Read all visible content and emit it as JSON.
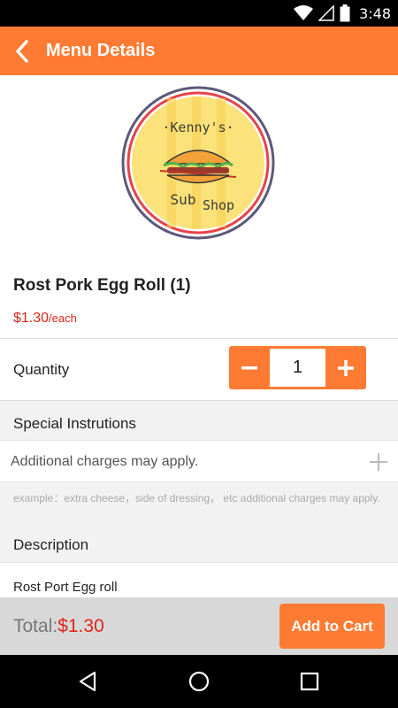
{
  "status_bar": {
    "time": "3:48",
    "icons": [
      "wifi-icon",
      "signal-icon",
      "battery-icon"
    ]
  },
  "app_bar": {
    "title": "Menu Details",
    "back_icon": "chevron-left-icon"
  },
  "logo": {
    "line1": "·Kenny's·",
    "line2a": "Sub",
    "line2b": "Shop"
  },
  "item": {
    "name": "Rost Pork Egg Roll (1)",
    "price": "$1.30",
    "price_unit": "/each"
  },
  "quantity": {
    "label": "Quantity",
    "value": "1",
    "minus_label": "−",
    "plus_label": "+"
  },
  "special_instructions": {
    "heading": "Special Instrutions",
    "placeholder": "Additional charges may apply.",
    "hint": "example：extra cheese，side of dressing， etc additional charges may apply."
  },
  "description": {
    "heading": "Description",
    "text": "Rost Port Egg roll"
  },
  "footer": {
    "total_label": "Total:",
    "total_amount": "$1.30",
    "add_to_cart": "Add to Cart"
  },
  "nav_bar": {
    "buttons": [
      "back-triangle-icon",
      "home-circle-icon",
      "recents-square-icon"
    ]
  },
  "colors": {
    "accent": "#ff7b33",
    "price_red": "#e0241b"
  }
}
